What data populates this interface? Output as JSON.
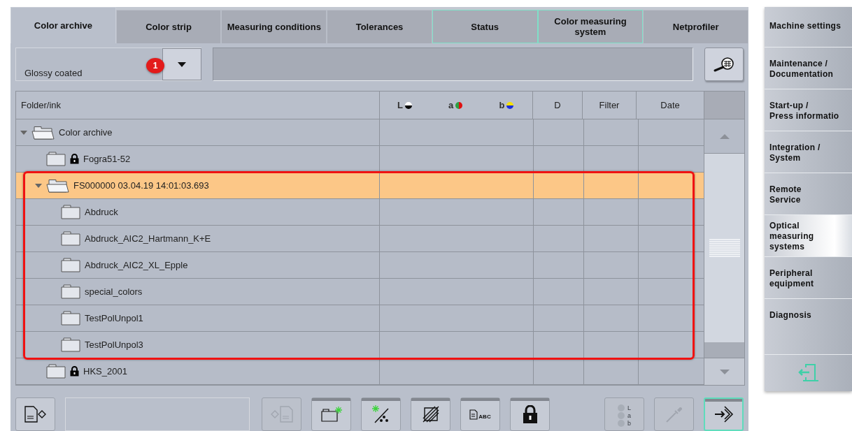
{
  "tabs": [
    {
      "label": "Color archive",
      "selected": true,
      "outlined": false
    },
    {
      "label": "Color strip",
      "selected": false,
      "outlined": false
    },
    {
      "label": "Measuring conditions",
      "selected": false,
      "outlined": false
    },
    {
      "label": "Tolerances",
      "selected": false,
      "outlined": false
    },
    {
      "label": "Status",
      "selected": false,
      "outlined": true
    },
    {
      "label": "Color measuring system",
      "selected": false,
      "outlined": true
    },
    {
      "label": "Netprofiler",
      "selected": false,
      "outlined": false
    }
  ],
  "filter": {
    "dropdown_value": "Glossy coated",
    "badge": "1"
  },
  "table": {
    "columns": [
      {
        "label": "Folder/ink",
        "kind": "text"
      },
      {
        "label": "L",
        "kind": "lightness"
      },
      {
        "label": "a",
        "kind": "red-green"
      },
      {
        "label": "b",
        "kind": "yellow-blue"
      },
      {
        "label": "D",
        "kind": "text"
      },
      {
        "label": "Filter",
        "kind": "text"
      },
      {
        "label": "Date",
        "kind": "text"
      }
    ],
    "tree": [
      {
        "name": "Color archive",
        "expanded": true,
        "selected": false,
        "locked": false,
        "framed": false,
        "children": [
          {
            "name": "Fogra51-52",
            "expanded": false,
            "selected": false,
            "locked": true,
            "framed": false
          },
          {
            "name": "FS000000 03.04.19 14:01:03.693",
            "expanded": true,
            "selected": true,
            "locked": false,
            "framed": true,
            "children": [
              {
                "name": "Abdruck",
                "expanded": false,
                "selected": false,
                "locked": false,
                "framed": false
              },
              {
                "name": "Abdruck_AIC2_Hartmann_K+E",
                "expanded": false,
                "selected": false,
                "locked": false,
                "framed": false
              },
              {
                "name": "Abdruck_AIC2_XL_Epple",
                "expanded": false,
                "selected": false,
                "locked": false,
                "framed": false
              },
              {
                "name": "special_colors",
                "expanded": false,
                "selected": false,
                "locked": false,
                "framed": false
              },
              {
                "name": "TestPolUnpol1",
                "expanded": false,
                "selected": false,
                "locked": false,
                "framed": false
              },
              {
                "name": "TestPolUnpol3",
                "expanded": false,
                "selected": false,
                "locked": false,
                "framed": false
              }
            ]
          },
          {
            "name": "HKS_2001",
            "expanded": false,
            "selected": false,
            "locked": true,
            "framed": false
          }
        ]
      }
    ]
  },
  "toolbar": [
    {
      "kind": "export",
      "disabled": false,
      "marked": false,
      "active": false
    },
    {
      "kind": "text-field"
    },
    {
      "kind": "import",
      "disabled": true,
      "marked": false,
      "active": false
    },
    {
      "kind": "new-folder",
      "disabled": false,
      "marked": true,
      "active": false
    },
    {
      "kind": "new-color",
      "disabled": false,
      "marked": true,
      "active": false
    },
    {
      "kind": "hatch",
      "disabled": false,
      "marked": true,
      "active": false
    },
    {
      "kind": "rename",
      "disabled": false,
      "marked": true,
      "active": false,
      "label": "ABC"
    },
    {
      "kind": "lock",
      "disabled": false,
      "marked": true,
      "active": false
    },
    {
      "kind": "lab",
      "disabled": true,
      "marked": false,
      "active": false,
      "letters": [
        "L",
        "a",
        "b"
      ]
    },
    {
      "kind": "pipette",
      "disabled": true,
      "marked": false,
      "active": false
    },
    {
      "kind": "enter",
      "disabled": false,
      "marked": true,
      "active": true
    }
  ],
  "sidebar": [
    {
      "label": "Machine settings",
      "selected": false
    },
    {
      "label": "Maintenance /\nDocumentation",
      "selected": false
    },
    {
      "label": "Start-up /\nPress informatio",
      "selected": false
    },
    {
      "label": "Integration /\nSystem",
      "selected": false
    },
    {
      "label": "Remote\nService",
      "selected": false
    },
    {
      "label": "Optical\nmeasuring\nsystems",
      "selected": true
    },
    {
      "label": "Peripheral\nequipment",
      "selected": false
    },
    {
      "label": "Diagnosis",
      "selected": false
    }
  ]
}
